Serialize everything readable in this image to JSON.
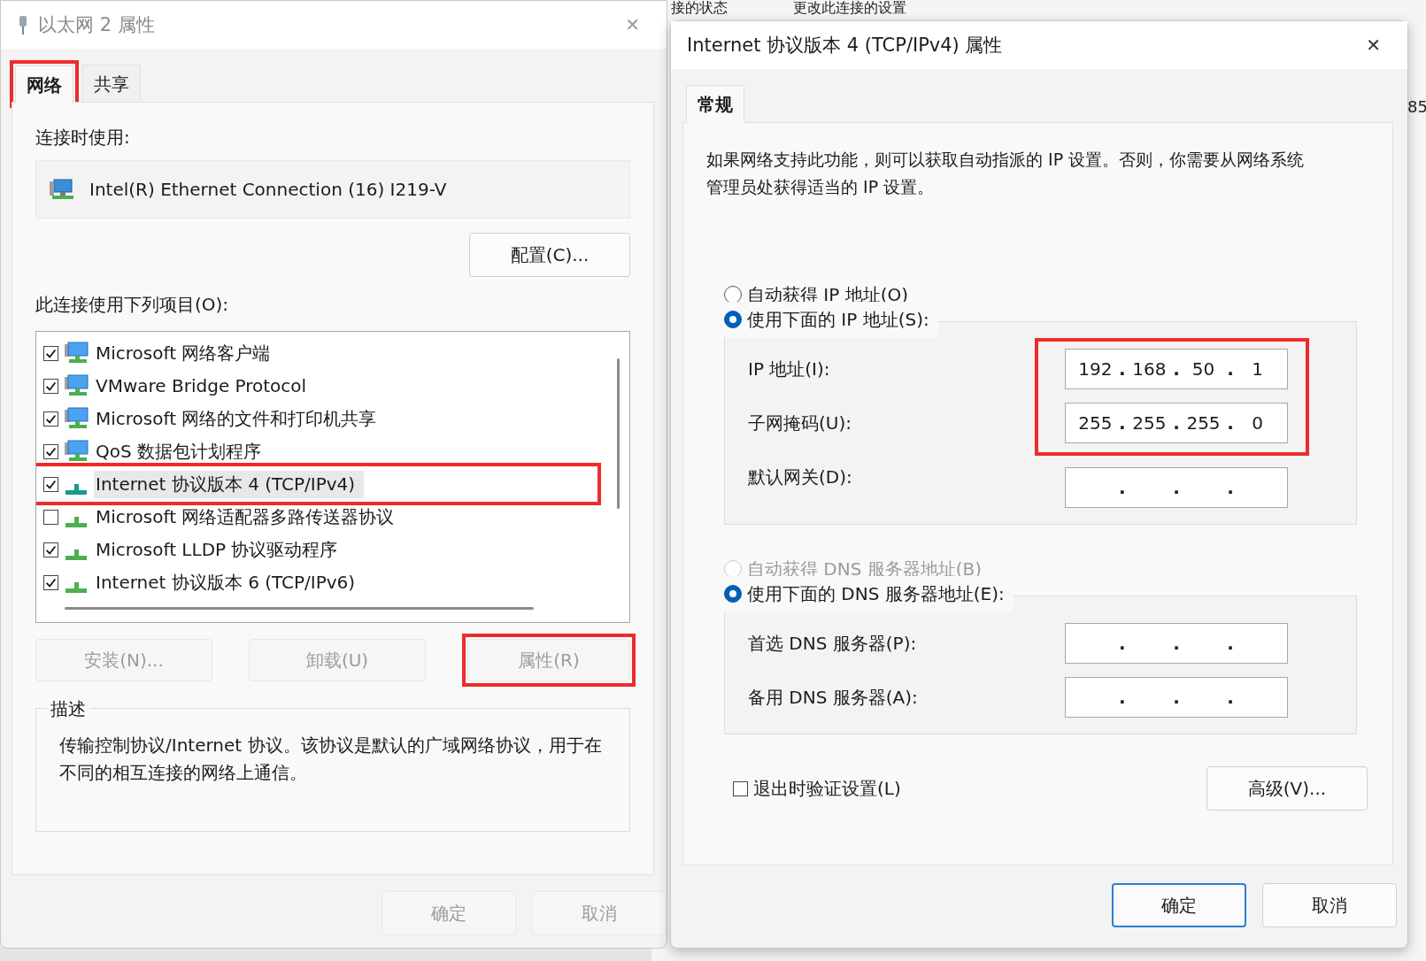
{
  "background_window": {
    "texts": [
      "接的状态",
      "更改此连接的设置",
      "85"
    ]
  },
  "left_dialog": {
    "title": "以太网 2 属性",
    "close": "✕",
    "tabs": [
      {
        "label": "网络",
        "selected": true,
        "highlighted": true
      },
      {
        "label": "共享",
        "selected": false,
        "highlighted": false
      }
    ],
    "connect_using_label": "连接时使用:",
    "adapter": "Intel(R) Ethernet Connection (16) I219-V",
    "configure_button": "配置(C)...",
    "items_label": "此连接使用下列项目(O):",
    "items": [
      {
        "label": "Microsoft 网络客户端",
        "kind": "service",
        "checked": true,
        "selected": false,
        "highlighted": false
      },
      {
        "label": "VMware Bridge Protocol",
        "kind": "service",
        "checked": true,
        "selected": false,
        "highlighted": false
      },
      {
        "label": "Microsoft 网络的文件和打印机共享",
        "kind": "service",
        "checked": true,
        "selected": false,
        "highlighted": false
      },
      {
        "label": "QoS 数据包计划程序",
        "kind": "service",
        "checked": true,
        "selected": false,
        "highlighted": false
      },
      {
        "label": "Internet 协议版本 4 (TCP/IPv4)",
        "kind": "protocol",
        "checked": true,
        "selected": true,
        "highlighted": true
      },
      {
        "label": "Microsoft 网络适配器多路传送器协议",
        "kind": "protocol",
        "checked": false,
        "selected": false,
        "highlighted": false
      },
      {
        "label": "Microsoft LLDP 协议驱动程序",
        "kind": "protocol",
        "checked": true,
        "selected": false,
        "highlighted": false
      },
      {
        "label": "Internet 协议版本 6 (TCP/IPv6)",
        "kind": "protocol",
        "checked": true,
        "selected": false,
        "highlighted": false
      }
    ],
    "buttons": [
      {
        "label": "安装(N)...",
        "disabled": true,
        "highlighted": false
      },
      {
        "label": "卸载(U)",
        "disabled": true,
        "highlighted": false
      },
      {
        "label": "属性(R)",
        "disabled": true,
        "highlighted": true
      }
    ],
    "description": {
      "legend": "描述",
      "text": "传输控制协议/Internet 协议。该协议是默认的广域网络协议，用于在不同的相互连接的网络上通信。"
    },
    "footer_buttons": [
      {
        "label": "确定",
        "disabled": true,
        "default": false
      },
      {
        "label": "取消",
        "disabled": true,
        "default": false
      }
    ]
  },
  "right_dialog": {
    "title": "Internet 协议版本 4 (TCP/IPv4) 属性",
    "close": "✕",
    "tabs": [
      {
        "label": "常规",
        "selected": true
      }
    ],
    "intro": "如果网络支持此功能，则可以获取自动指派的 IP 设置。否则，你需要从网络系统管理员处获得适当的 IP 设置。",
    "separator": ".",
    "ip_mode": [
      {
        "label": "自动获得 IP 地址(O)",
        "selected": false,
        "disabled": false
      },
      {
        "label": "使用下面的 IP 地址(S):",
        "selected": true,
        "disabled": false
      }
    ],
    "ip_fields_highlighted": true,
    "ip_fields": [
      {
        "label": "IP 地址(I):",
        "octets": [
          "192",
          "168",
          "50",
          "1"
        ]
      },
      {
        "label": "子网掩码(U):",
        "octets": [
          "255",
          "255",
          "255",
          "0"
        ]
      },
      {
        "label": "默认网关(D):"
      }
    ],
    "dns_mode": [
      {
        "label": "自动获得 DNS 服务器地址(B)",
        "selected": false,
        "disabled": true
      },
      {
        "label": "使用下面的 DNS 服务器地址(E):",
        "selected": true,
        "disabled": false
      }
    ],
    "dns_fields": [
      {
        "label": "首选 DNS 服务器(P):"
      },
      {
        "label": "备用 DNS 服务器(A):"
      }
    ],
    "validate_on_exit": {
      "label": "退出时验证设置(L)",
      "checked": false
    },
    "advanced_button": "高级(V)...",
    "footer_buttons": [
      {
        "label": "确定",
        "disabled": false,
        "default": true
      },
      {
        "label": "取消",
        "disabled": false,
        "default": false
      }
    ]
  }
}
